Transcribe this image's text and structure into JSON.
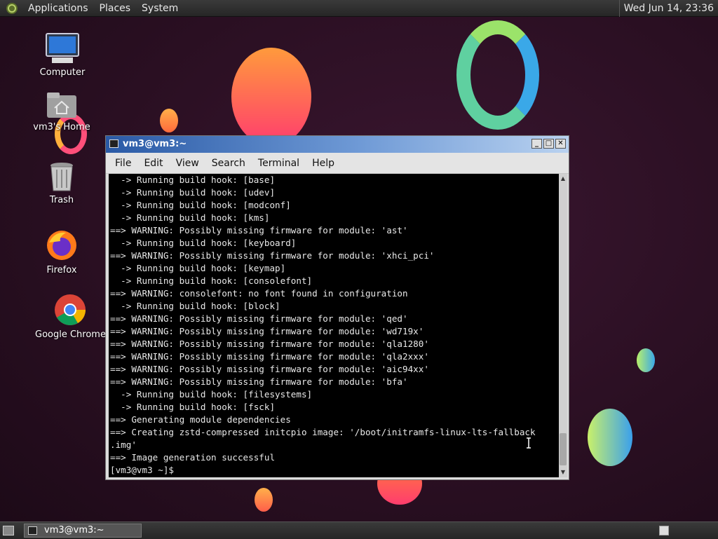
{
  "top_panel": {
    "menus": [
      "Applications",
      "Places",
      "System"
    ],
    "clock": "Wed Jun 14, 23:36"
  },
  "desktop_icons": [
    {
      "label": "Computer",
      "icon": "computer-icon"
    },
    {
      "label": "vm3's Home",
      "icon": "home-folder-icon"
    },
    {
      "label": "Trash",
      "icon": "trash-icon"
    },
    {
      "label": "Firefox",
      "icon": "firefox-icon"
    },
    {
      "label": "Google Chrome",
      "icon": "chrome-icon"
    }
  ],
  "window": {
    "title": "vm3@vm3:~",
    "buttons": [
      "_",
      "□",
      "✕"
    ],
    "menus": [
      "File",
      "Edit",
      "View",
      "Search",
      "Terminal",
      "Help"
    ],
    "terminal_lines": [
      "  -> Running build hook: [base]",
      "  -> Running build hook: [udev]",
      "  -> Running build hook: [modconf]",
      "  -> Running build hook: [kms]",
      "==> WARNING: Possibly missing firmware for module: 'ast'",
      "  -> Running build hook: [keyboard]",
      "==> WARNING: Possibly missing firmware for module: 'xhci_pci'",
      "  -> Running build hook: [keymap]",
      "  -> Running build hook: [consolefont]",
      "==> WARNING: consolefont: no font found in configuration",
      "  -> Running build hook: [block]",
      "==> WARNING: Possibly missing firmware for module: 'qed'",
      "==> WARNING: Possibly missing firmware for module: 'wd719x'",
      "==> WARNING: Possibly missing firmware for module: 'qla1280'",
      "==> WARNING: Possibly missing firmware for module: 'qla2xxx'",
      "==> WARNING: Possibly missing firmware for module: 'aic94xx'",
      "==> WARNING: Possibly missing firmware for module: 'bfa'",
      "  -> Running build hook: [filesystems]",
      "  -> Running build hook: [fsck]",
      "==> Generating module dependencies",
      "==> Creating zstd-compressed initcpio image: '/boot/initramfs-linux-lts-fallback",
      ".img'",
      "==> Image generation successful",
      "[vm3@vm3 ~]$ "
    ]
  },
  "taskbar": {
    "task_label": "vm3@vm3:~"
  },
  "colors": {
    "titlebar_start": "#2a5aa6",
    "terminal_bg": "#000000",
    "terminal_fg": "#e8e8e8"
  }
}
